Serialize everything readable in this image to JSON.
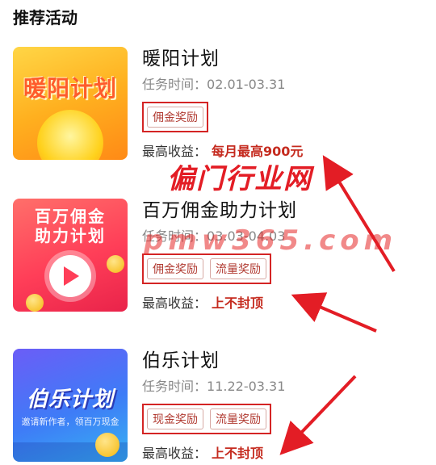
{
  "section": {
    "title": "推荐活动"
  },
  "activities": [
    {
      "thumb_text": "暖阳计划",
      "title": "暖阳计划",
      "time_label": "任务时间：",
      "time_range": "02.01-03.31",
      "tags": [
        "佣金奖励"
      ],
      "earn_label": "最高收益：",
      "earn_value": "每月最高900元"
    },
    {
      "thumb_text_line1": "百万佣金",
      "thumb_text_line2": "助力计划",
      "title": "百万佣金助力计划",
      "time_label": "任务时间：",
      "time_range": "03.03-04.03",
      "tags": [
        "佣金奖励",
        "流量奖励"
      ],
      "earn_label": "最高收益：",
      "earn_value": "上不封顶"
    },
    {
      "thumb_text": "伯乐计划",
      "thumb_subtext": "邀请新作者，领百万现金",
      "title": "伯乐计划",
      "time_label": "任务时间：",
      "time_range": "11.22-03.31",
      "tags": [
        "现金奖励",
        "流量奖励"
      ],
      "earn_label": "最高收益：",
      "earn_value": "上不封顶"
    }
  ],
  "watermark": {
    "text_cn": "偏门行业网",
    "text_en": "pmw365.com"
  },
  "colors": {
    "accent_red": "#c52b1f",
    "annotation_red": "#e31d25",
    "tag_text": "#b13b32"
  }
}
